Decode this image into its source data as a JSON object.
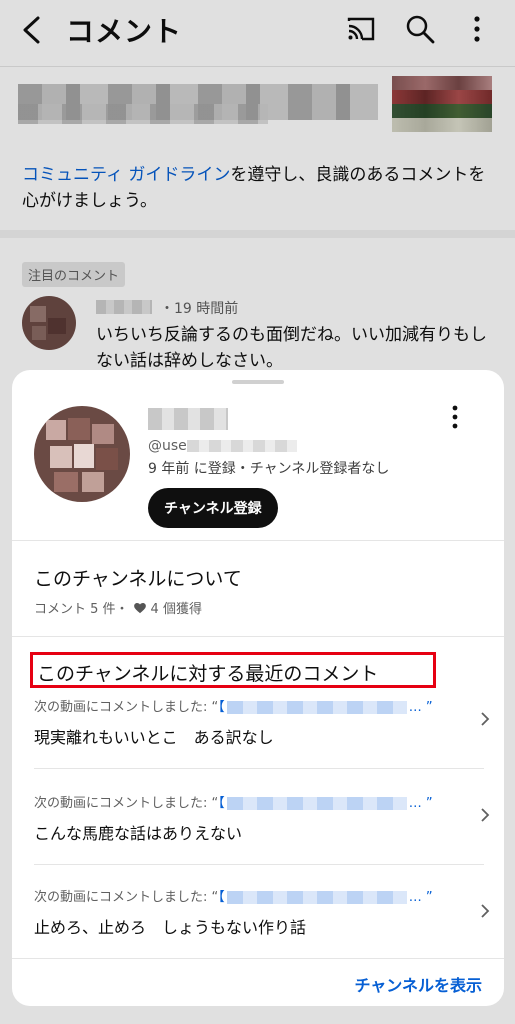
{
  "header": {
    "title": "コメント"
  },
  "guideline": {
    "link": "コミュニティ ガイドライン",
    "rest": "を遵守し、良識のあるコメントを心がけましょう。"
  },
  "pinned_comment": {
    "label": "注目のコメント",
    "meta": "・19 時間前",
    "text": "いちいち反論するのも面倒だね。いい加減有りもしない話は辞めしなさい。"
  },
  "sheet": {
    "handle_prefix": "@use",
    "meta": "9 年前 に登録・チャンネル登録者なし",
    "subscribe_label": "チャンネル登録",
    "about_title": "このチャンネルについて",
    "stats_comments": "コメント 5 件・",
    "stats_likes": "4 個獲得",
    "recent_title": "このチャンネルに対する最近のコメント",
    "recent_comments": [
      {
        "prefix": "次の動画にコメントしました: “",
        "link_start": "【",
        "suffix": "… ”",
        "text": "現実離れもいいとこ　ある訳なし"
      },
      {
        "prefix": "次の動画にコメントしました: “",
        "link_start": "【",
        "suffix": "… ”",
        "text": "こんな馬鹿な話はありえない"
      },
      {
        "prefix": "次の動画にコメントしました: “",
        "link_start": "【",
        "suffix": "… ”",
        "text": "止めろ、止めろ　しょうもない作り話"
      }
    ],
    "view_channel_label": "チャンネルを表示"
  },
  "colors": {
    "link": "#065fd4",
    "highlight_box": "#e60012",
    "subscribe_bg": "#0f0f0f"
  },
  "icons": [
    "back-icon",
    "cast-icon",
    "search-icon",
    "more-vert-icon",
    "heart-icon",
    "chevron-right-icon"
  ]
}
